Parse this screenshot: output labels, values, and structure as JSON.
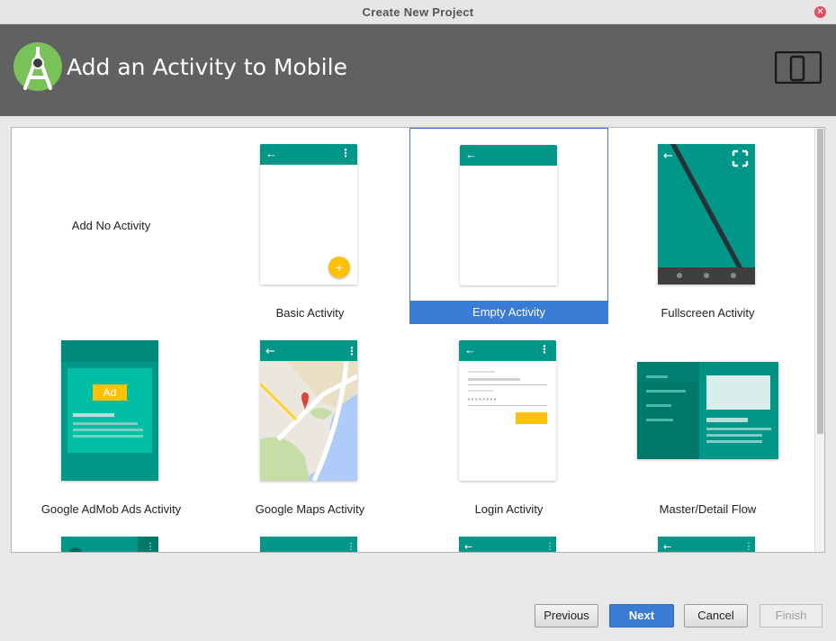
{
  "window": {
    "title": "Create New Project"
  },
  "header": {
    "heading": "Add an Activity to Mobile",
    "logo_icon": "android-studio-icon",
    "device_icon": "phone-tablet-icon"
  },
  "gallery": {
    "items": [
      {
        "label": "Add No Activity"
      },
      {
        "label": "Basic Activity"
      },
      {
        "label": "Empty Activity",
        "selected": true
      },
      {
        "label": "Fullscreen Activity"
      },
      {
        "label": "Google AdMob Ads Activity",
        "ad_badge": "Ad"
      },
      {
        "label": "Google Maps Activity"
      },
      {
        "label": "Login Activity"
      },
      {
        "label": "Master/Detail Flow"
      }
    ]
  },
  "footer": {
    "previous": "Previous",
    "next": "Next",
    "cancel": "Cancel",
    "finish": "Finish"
  },
  "colors": {
    "teal": "#009688",
    "selection": "#3a7bd5",
    "header": "#616161",
    "fab": "#ffc107"
  }
}
